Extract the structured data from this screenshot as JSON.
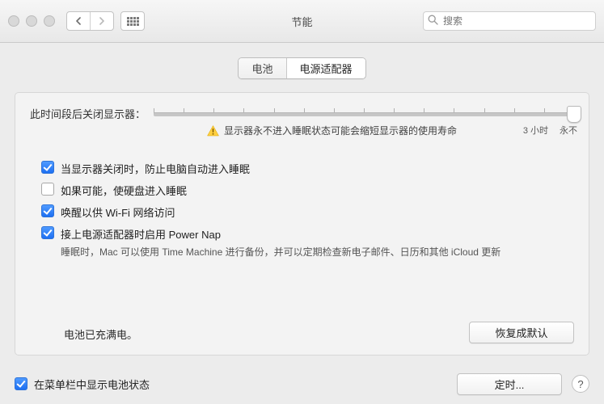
{
  "window": {
    "title": "节能",
    "search_placeholder": "搜索"
  },
  "tabs": {
    "battery": "电池",
    "adapter": "电源适配器",
    "selected_index": 1
  },
  "slider": {
    "label": "此时间段后关闭显示器：",
    "min_label": "3 小时",
    "max_label": "永不",
    "value_position_percent": 100,
    "warning_text": "显示器永不进入睡眠状态可能会缩短显示器的使用寿命"
  },
  "options": [
    {
      "checked": true,
      "label": "当显示器关闭时，防止电脑自动进入睡眠"
    },
    {
      "checked": false,
      "label": "如果可能，使硬盘进入睡眠"
    },
    {
      "checked": true,
      "label": "唤醒以供 Wi-Fi 网络访问"
    },
    {
      "checked": true,
      "label": "接上电源适配器时启用 Power Nap",
      "sub": "睡眠时，Mac 可以使用 Time Machine 进行备份，并可以定期检查新电子邮件、日历和其他 iCloud 更新"
    }
  ],
  "battery_status": "电池已充满电。",
  "restore_defaults_label": "恢复成默认",
  "menubar_checkbox": {
    "checked": true,
    "label": "在菜单栏中显示电池状态"
  },
  "schedule_button_label": "定时...",
  "help_label": "?"
}
